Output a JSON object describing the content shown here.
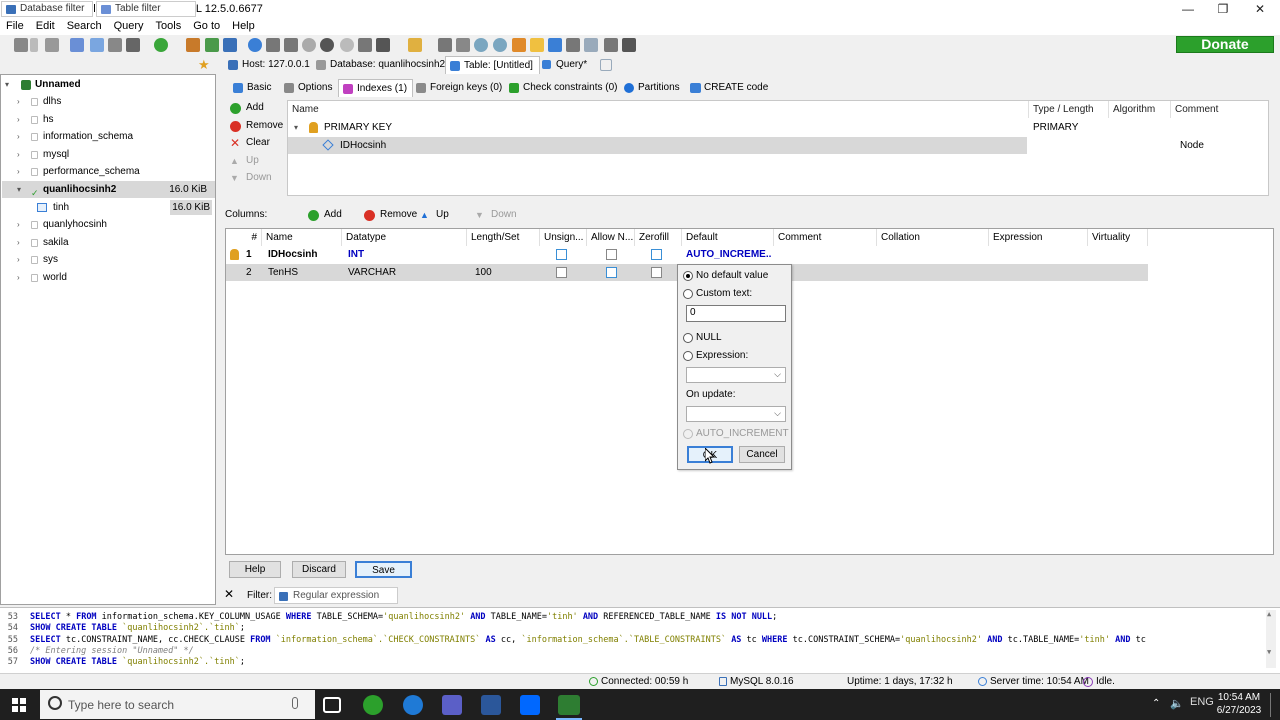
{
  "window": {
    "title": "Unnamed\\quanlihocsinh2\\ - HeidiSQL 12.5.0.6677"
  },
  "menu": [
    "File",
    "Edit",
    "Search",
    "Query",
    "Tools",
    "Go to",
    "Help"
  ],
  "donate_label": "Donate",
  "filters": {
    "database": "Database filter",
    "table": "Table filter"
  },
  "top_tabs": [
    "Host: 127.0.0.1",
    "Database: quanlihocsinh2",
    "Table: [Untitled]",
    "Query*"
  ],
  "tree": {
    "root": "Unnamed",
    "databases": [
      "dlhs",
      "hs",
      "information_schema",
      "mysql",
      "performance_schema",
      "quanlihocsinh2",
      "quanlyhocsinh",
      "sakila",
      "sys",
      "world"
    ],
    "selected_size": "16.0 KiB",
    "table": "tinh",
    "table_size": "16.0 KiB"
  },
  "sub_tabs": [
    "Basic",
    "Options",
    "Indexes (1)",
    "Foreign keys (0)",
    "Check constraints (0)",
    "Partitions",
    "CREATE code"
  ],
  "index_buttons": [
    "Add",
    "Remove",
    "Clear",
    "Up",
    "Down"
  ],
  "index_grid": {
    "headers": [
      "Name",
      "Type / Length",
      "Algorithm",
      "Comment"
    ],
    "primary_key": "PRIMARY KEY",
    "primary_type": "PRIMARY",
    "column": "IDHocsinh",
    "column_note": "Node"
  },
  "columns_toolbar": {
    "label": "Columns:",
    "add": "Add",
    "remove": "Remove",
    "up": "Up",
    "down": "Down"
  },
  "columns_grid": {
    "headers": [
      "#",
      "Name",
      "Datatype",
      "Length/Set",
      "Unsign...",
      "Allow N...",
      "Zerofill",
      "Default",
      "Comment",
      "Collation",
      "Expression",
      "Virtuality"
    ],
    "rows": [
      {
        "num": "1",
        "name": "IDHocsinh",
        "datatype": "INT",
        "length": "",
        "default": "AUTO_INCREME..."
      },
      {
        "num": "2",
        "name": "TenHS",
        "datatype": "VARCHAR",
        "length": "100",
        "default": ""
      }
    ]
  },
  "default_popup": {
    "no_default": "No default value",
    "custom_text": "Custom text:",
    "custom_value": "0",
    "null": "NULL",
    "expression": "Expression:",
    "on_update": "On update:",
    "auto_increment": "AUTO_INCREMENT",
    "ok": "OK",
    "cancel": "Cancel"
  },
  "bottom_buttons": [
    "Help",
    "Discard",
    "Save"
  ],
  "filter_bar": {
    "label": "Filter:",
    "placeholder": "Regular expression"
  },
  "log": [
    {
      "n": "53",
      "parts": [
        [
          "kw",
          "SELECT"
        ],
        [
          "t",
          " * "
        ],
        [
          "kw",
          "FROM"
        ],
        [
          "t",
          " information_schema.KEY_COLUMN_USAGE "
        ],
        [
          "kw",
          "WHERE"
        ],
        [
          "t",
          "   TABLE_SCHEMA="
        ],
        [
          "str",
          "'quanlihocsinh2'"
        ],
        [
          "t",
          "   "
        ],
        [
          "kw",
          "AND"
        ],
        [
          "t",
          " TABLE_NAME="
        ],
        [
          "str",
          "'tinh'"
        ],
        [
          "t",
          "   "
        ],
        [
          "kw",
          "AND"
        ],
        [
          "t",
          " REFERENCED_TABLE_NAME "
        ],
        [
          "kw",
          "IS NOT NULL"
        ],
        [
          "t",
          ";"
        ]
      ]
    },
    {
      "n": "54",
      "parts": [
        [
          "kw",
          "SHOW CREATE TABLE"
        ],
        [
          "t",
          " "
        ],
        [
          "str",
          "`quanlihocsinh2`.`tinh`"
        ],
        [
          "t",
          ";"
        ]
      ]
    },
    {
      "n": "55",
      "parts": [
        [
          "kw",
          "SELECT"
        ],
        [
          "t",
          " tc.CONSTRAINT_NAME, cc.CHECK_CLAUSE "
        ],
        [
          "kw",
          "FROM"
        ],
        [
          "t",
          " "
        ],
        [
          "str",
          "`information_schema`.`CHECK_CONSTRAINTS`"
        ],
        [
          "t",
          " "
        ],
        [
          "kw",
          "AS"
        ],
        [
          "t",
          " cc, "
        ],
        [
          "str",
          "`information_schema`.`TABLE_CONSTRAINTS`"
        ],
        [
          "t",
          " "
        ],
        [
          "kw",
          "AS"
        ],
        [
          "t",
          " tc "
        ],
        [
          "kw",
          "WHERE"
        ],
        [
          "t",
          " tc.CONSTRAINT_SCHEMA="
        ],
        [
          "str",
          "'quanlihocsinh2'"
        ],
        [
          "t",
          " "
        ],
        [
          "kw",
          "AND"
        ],
        [
          "t",
          " tc.TABLE_NAME="
        ],
        [
          "str",
          "'tinh'"
        ],
        [
          "t",
          " "
        ],
        [
          "kw",
          "AND"
        ],
        [
          "t",
          " tc"
        ]
      ]
    },
    {
      "n": "56",
      "parts": [
        [
          "cm",
          "/* Entering session \"Unnamed\" */"
        ]
      ]
    },
    {
      "n": "57",
      "parts": [
        [
          "kw",
          "SHOW CREATE TABLE"
        ],
        [
          "t",
          " "
        ],
        [
          "str",
          "`quanlihocsinh2`.`tinh`"
        ],
        [
          "t",
          ";"
        ]
      ]
    }
  ],
  "status": {
    "connected": "Connected: 00:59 h",
    "server": "MySQL 8.0.16",
    "uptime": "Uptime: 1 days, 17:32 h",
    "server_time": "Server time: 10:54 AM",
    "state": "Idle."
  },
  "taskbar": {
    "search_placeholder": "Type here to search",
    "time": "10:54 AM",
    "date": "6/27/2023"
  },
  "colors": {
    "accent": "#0000c0",
    "donate": "#2ca02c",
    "selection": "#d8d8d8"
  }
}
